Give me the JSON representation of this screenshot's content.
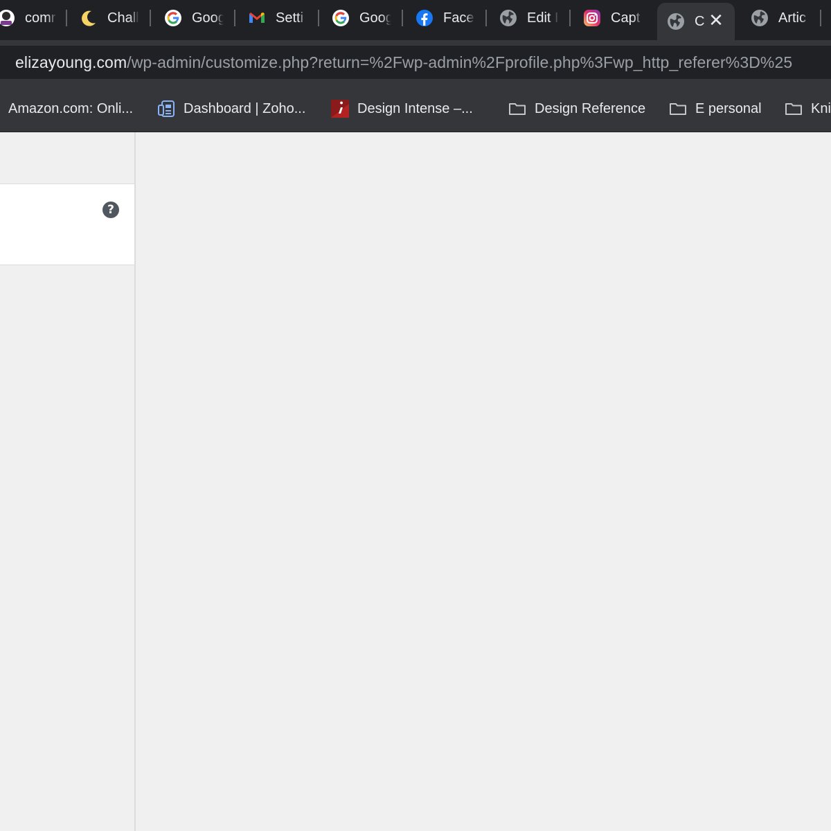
{
  "browser": {
    "tabs": [
      {
        "title": "comr",
        "icon": "profile-avatar-icon"
      },
      {
        "title": "Chall",
        "icon": "moon-icon"
      },
      {
        "title": "Goog",
        "icon": "google-icon"
      },
      {
        "title": "Setti",
        "icon": "gmail-icon"
      },
      {
        "title": "Goog",
        "icon": "google-icon"
      },
      {
        "title": "Face",
        "icon": "facebook-icon"
      },
      {
        "title": "Edit I",
        "icon": "globe-icon"
      },
      {
        "title": "Capt",
        "icon": "instagram-icon"
      },
      {
        "title": "C",
        "icon": "globe-icon",
        "active": true
      },
      {
        "title": "Artic",
        "icon": "globe-icon"
      }
    ],
    "active_tab_close": "✕",
    "address": {
      "host": "elizayoung.com",
      "path": "/wp-admin/customize.php?return=%2Fwp-admin%2Fprofile.php%3Fwp_http_referer%3D%25"
    },
    "bookmarks": [
      {
        "label": "Amazon.com: Onli...",
        "icon": "amazon-icon"
      },
      {
        "label": "Dashboard | Zoho...",
        "icon": "zoho-icon"
      },
      {
        "label": "Design Intense –...",
        "icon": "design-intense-icon"
      },
      {
        "label": "Design Reference",
        "icon": "folder-icon"
      },
      {
        "label": "E personal",
        "icon": "folder-icon"
      },
      {
        "label": "Kni",
        "icon": "folder-icon"
      }
    ]
  },
  "customizer": {
    "help_glyph": "?"
  },
  "colors": {
    "tab_strip": "#202124",
    "toolbar": "#35363a",
    "page_bg": "#f0f0f1",
    "panel_bg": "#ffffff",
    "help_icon": "#50575e"
  }
}
